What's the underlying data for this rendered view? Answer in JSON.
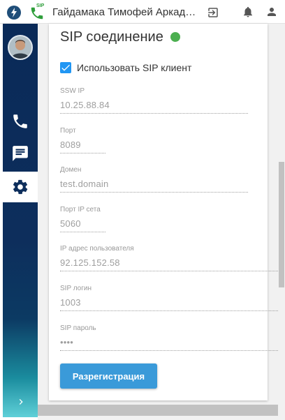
{
  "titlebar": {
    "sip_badge": "SIP",
    "user_name": "Гайдамака Тимофей Аркадьевич"
  },
  "sidebar": {
    "items": [
      {
        "icon": "phone-icon"
      },
      {
        "icon": "chat-icon"
      },
      {
        "icon": "gear-icon"
      }
    ]
  },
  "sip": {
    "title": "SIP соединение",
    "status_color": "#4caf50",
    "use_sip_label": "Использовать SIP клиент",
    "use_sip_checked": true,
    "fields": {
      "ssw_ip": {
        "label": "SSW IP",
        "value": "10.25.88.84"
      },
      "port": {
        "label": "Порт",
        "value": "8089"
      },
      "domain": {
        "label": "Домен",
        "value": "test.domain"
      },
      "net_port": {
        "label": "Порт IP сета",
        "value": "5060"
      },
      "user_ip": {
        "label": "IP адрес пользователя",
        "value": "92.125.152.58"
      },
      "login": {
        "label": "SIP логин",
        "value": "1003"
      },
      "password": {
        "label": "SIP пароль",
        "value": "••••"
      }
    },
    "button_label": "Разрегистрация"
  },
  "colors": {
    "accent": "#3a9ad9",
    "checkbox": "#2196f3",
    "sidebar_dark": "#0a2a58",
    "sidebar_light": "#5fd0d8"
  }
}
